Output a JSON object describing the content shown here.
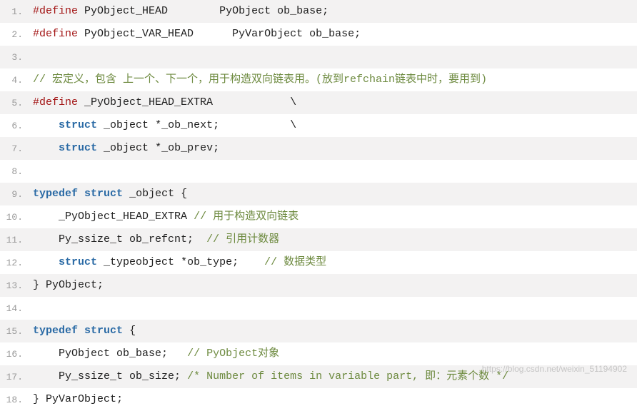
{
  "code": {
    "lines": [
      {
        "n": "1.",
        "tokens": [
          {
            "c": "pp",
            "t": "#define"
          },
          {
            "c": "sp",
            "t": " "
          },
          {
            "c": "ident",
            "t": "PyObject_HEAD"
          },
          {
            "c": "sp",
            "t": "        "
          },
          {
            "c": "ident",
            "t": "PyObject ob_base"
          },
          {
            "c": "punct",
            "t": ";"
          }
        ]
      },
      {
        "n": "2.",
        "tokens": [
          {
            "c": "pp",
            "t": "#define"
          },
          {
            "c": "sp",
            "t": " "
          },
          {
            "c": "ident",
            "t": "PyObject_VAR_HEAD"
          },
          {
            "c": "sp",
            "t": "      "
          },
          {
            "c": "ident",
            "t": "PyVarObject ob_base"
          },
          {
            "c": "punct",
            "t": ";"
          }
        ]
      },
      {
        "n": "3.",
        "tokens": []
      },
      {
        "n": "4.",
        "tokens": [
          {
            "c": "cm",
            "t": "// 宏定义，包含 上一个、下一个，用于构造双向链表用。(放到refchain链表中时，要用到)"
          }
        ]
      },
      {
        "n": "5.",
        "tokens": [
          {
            "c": "pp",
            "t": "#define"
          },
          {
            "c": "sp",
            "t": " "
          },
          {
            "c": "ident",
            "t": "_PyObject_HEAD_EXTRA"
          },
          {
            "c": "sp",
            "t": "            "
          },
          {
            "c": "punct",
            "t": "\\"
          }
        ]
      },
      {
        "n": "6.",
        "tokens": [
          {
            "c": "sp",
            "t": "    "
          },
          {
            "c": "kw",
            "t": "struct"
          },
          {
            "c": "sp",
            "t": " "
          },
          {
            "c": "ident",
            "t": "_object"
          },
          {
            "c": "sp",
            "t": " "
          },
          {
            "c": "punct",
            "t": "*"
          },
          {
            "c": "ident",
            "t": "_ob_next"
          },
          {
            "c": "punct",
            "t": ";"
          },
          {
            "c": "sp",
            "t": "           "
          },
          {
            "c": "punct",
            "t": "\\"
          }
        ]
      },
      {
        "n": "7.",
        "tokens": [
          {
            "c": "sp",
            "t": "    "
          },
          {
            "c": "kw",
            "t": "struct"
          },
          {
            "c": "sp",
            "t": " "
          },
          {
            "c": "ident",
            "t": "_object"
          },
          {
            "c": "sp",
            "t": " "
          },
          {
            "c": "punct",
            "t": "*"
          },
          {
            "c": "ident",
            "t": "_ob_prev"
          },
          {
            "c": "punct",
            "t": ";"
          }
        ]
      },
      {
        "n": "8.",
        "tokens": []
      },
      {
        "n": "9.",
        "tokens": [
          {
            "c": "kw",
            "t": "typedef"
          },
          {
            "c": "sp",
            "t": " "
          },
          {
            "c": "kw",
            "t": "struct"
          },
          {
            "c": "sp",
            "t": " "
          },
          {
            "c": "ident",
            "t": "_object"
          },
          {
            "c": "sp",
            "t": " "
          },
          {
            "c": "punct",
            "t": "{"
          }
        ]
      },
      {
        "n": "10.",
        "tokens": [
          {
            "c": "sp",
            "t": "    "
          },
          {
            "c": "ident",
            "t": "_PyObject_HEAD_EXTRA"
          },
          {
            "c": "sp",
            "t": " "
          },
          {
            "c": "cm",
            "t": "// 用于构造双向链表"
          }
        ]
      },
      {
        "n": "11.",
        "tokens": [
          {
            "c": "sp",
            "t": "    "
          },
          {
            "c": "ident",
            "t": "Py_ssize_t ob_refcnt"
          },
          {
            "c": "punct",
            "t": ";"
          },
          {
            "c": "sp",
            "t": "  "
          },
          {
            "c": "cm",
            "t": "// 引用计数器"
          }
        ]
      },
      {
        "n": "12.",
        "tokens": [
          {
            "c": "sp",
            "t": "    "
          },
          {
            "c": "kw",
            "t": "struct"
          },
          {
            "c": "sp",
            "t": " "
          },
          {
            "c": "ident",
            "t": "_typeobject"
          },
          {
            "c": "sp",
            "t": " "
          },
          {
            "c": "punct",
            "t": "*"
          },
          {
            "c": "ident",
            "t": "ob_type"
          },
          {
            "c": "punct",
            "t": ";"
          },
          {
            "c": "sp",
            "t": "    "
          },
          {
            "c": "cm",
            "t": "// 数据类型"
          }
        ]
      },
      {
        "n": "13.",
        "tokens": [
          {
            "c": "punct",
            "t": "}"
          },
          {
            "c": "sp",
            "t": " "
          },
          {
            "c": "ident",
            "t": "PyObject"
          },
          {
            "c": "punct",
            "t": ";"
          }
        ]
      },
      {
        "n": "14.",
        "tokens": []
      },
      {
        "n": "15.",
        "tokens": [
          {
            "c": "kw",
            "t": "typedef"
          },
          {
            "c": "sp",
            "t": " "
          },
          {
            "c": "kw",
            "t": "struct"
          },
          {
            "c": "sp",
            "t": " "
          },
          {
            "c": "punct",
            "t": "{"
          }
        ]
      },
      {
        "n": "16.",
        "tokens": [
          {
            "c": "sp",
            "t": "    "
          },
          {
            "c": "ident",
            "t": "PyObject ob_base"
          },
          {
            "c": "punct",
            "t": ";"
          },
          {
            "c": "sp",
            "t": "   "
          },
          {
            "c": "cm",
            "t": "// PyObject对象"
          }
        ]
      },
      {
        "n": "17.",
        "tokens": [
          {
            "c": "sp",
            "t": "    "
          },
          {
            "c": "ident",
            "t": "Py_ssize_t ob_size"
          },
          {
            "c": "punct",
            "t": ";"
          },
          {
            "c": "sp",
            "t": " "
          },
          {
            "c": "cm",
            "t": "/* Number of items in variable part, 即：元素个数 */"
          }
        ]
      },
      {
        "n": "18.",
        "tokens": [
          {
            "c": "punct",
            "t": "}"
          },
          {
            "c": "sp",
            "t": " "
          },
          {
            "c": "ident",
            "t": "PyVarObject"
          },
          {
            "c": "punct",
            "t": ";"
          }
        ]
      }
    ]
  },
  "watermark": "https://blog.csdn.net/weixin_51194902"
}
